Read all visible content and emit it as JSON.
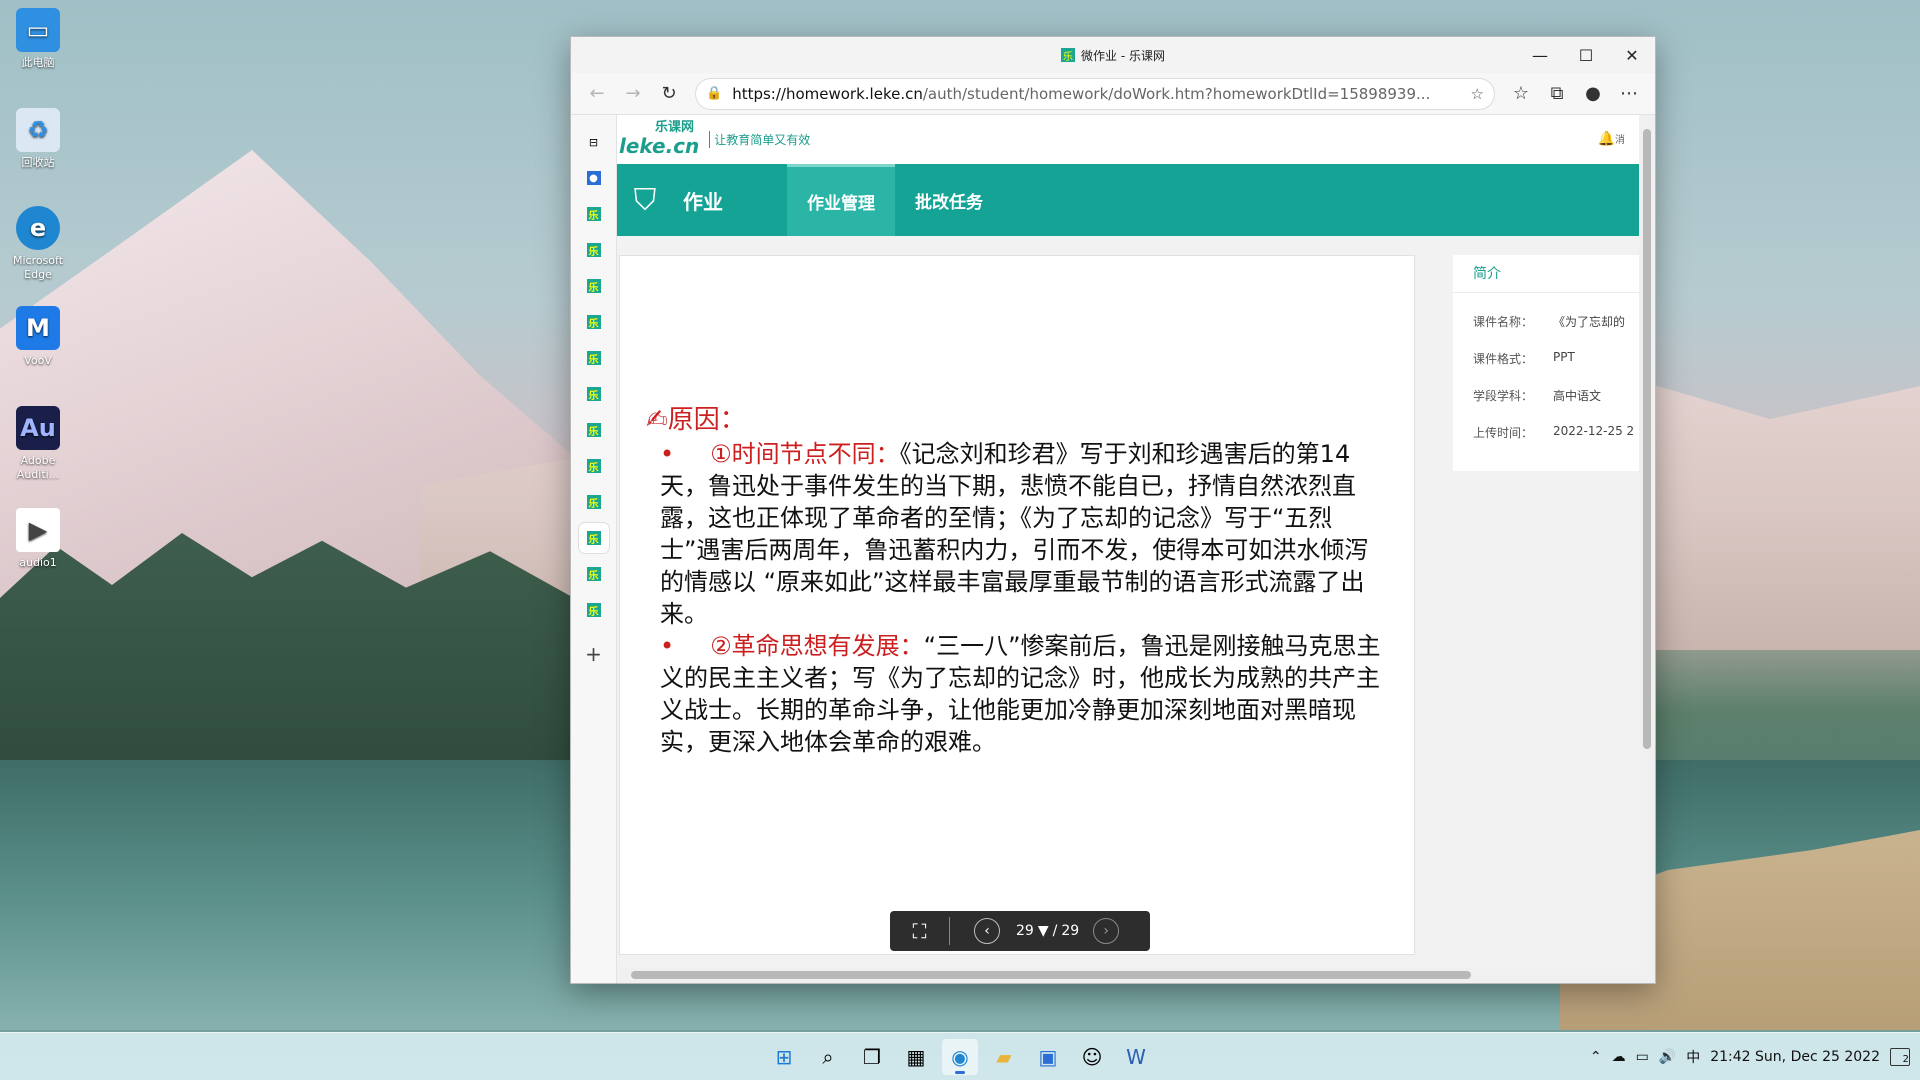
{
  "desktop": {
    "icons": [
      {
        "label": "此电脑",
        "glyph": "▭",
        "color": "#2f8fe0"
      },
      {
        "label": "回收站",
        "glyph": "♻",
        "color": "#6ab0e8"
      },
      {
        "label": "Microsoft Edge",
        "glyph": "e",
        "color": "#1f86d2"
      },
      {
        "label": "VooV",
        "glyph": "M",
        "color": "#1e7ae6"
      },
      {
        "label": "Adobe Auditi...",
        "glyph": "Au",
        "color": "#1a1f4a"
      },
      {
        "label": "audio1",
        "glyph": "▶",
        "color": "#444444"
      }
    ]
  },
  "browser": {
    "title": "微作业 - 乐课网",
    "favicon_text": "乐",
    "url_host": "https://homework.leke.cn",
    "url_path": "/auth/student/homework/doWork.htm?homeworkDtlId=15898939...",
    "sidebar_tab_text": "乐",
    "sidebar_add": "+"
  },
  "site": {
    "logo_top": "乐课网",
    "logo_main": "leke.cn",
    "slogan": "让教育简单又有效",
    "bell_label": "消",
    "section_title": "作业",
    "menu": [
      {
        "label": "作业管理"
      },
      {
        "label": "批改任务"
      }
    ]
  },
  "slide": {
    "heading": "原因：",
    "point1_title": "①时间节点不同：",
    "point1_body": "《记念刘和珍君》写于刘和珍遇害后的第14天，鲁迅处于事件发生的当下期，悲愤不能自已，抒情自然浓烈直露，这也正体现了革命者的至情；《为了忘却的记念》写于“五烈士”遇害后两周年，鲁迅蓄积内力，引而不发，使得本可如洪水倾泻的情感以 “原来如此”这样最丰富最厚重最节制的语言形式流露了出来。",
    "point2_title": "②革命思想有发展：",
    "point2_body": "“三一八”惨案前后，鲁迅是刚接触马克思主义的民主主义者；写《为了忘却的记念》时，他成长为成熟的共产主义战士。长期的革命斗争，让他能更加冷静更加深刻地面对黑暗现实，更深入地体会革命的艰难。"
  },
  "pager": {
    "current": "29",
    "separator": "/",
    "total": "29"
  },
  "info": {
    "title": "简介",
    "rows": [
      {
        "key": "课件名称：",
        "value": "《为了忘却的"
      },
      {
        "key": "课件格式：",
        "value": "PPT"
      },
      {
        "key": "学段学科：",
        "value": "高中语文"
      },
      {
        "key": "上传时间：",
        "value": "2022-12-25 2"
      }
    ]
  },
  "taskbar": {
    "ime": "中",
    "clock": "21:42 Sun, Dec 25 2022",
    "notification_count": "2"
  }
}
